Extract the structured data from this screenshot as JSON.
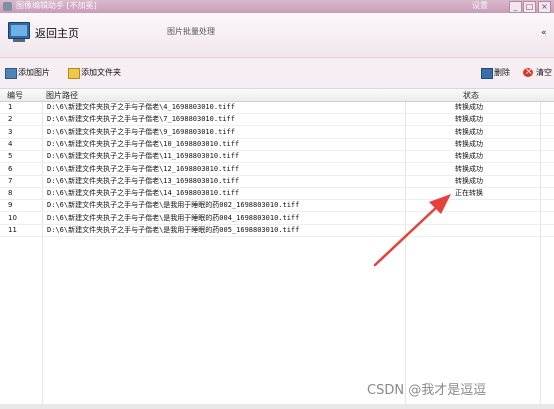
{
  "window": {
    "title": "图像编辑助手 [不加冕]",
    "extra": "设置",
    "buttons": [
      "_",
      "□",
      "×"
    ]
  },
  "header": {
    "back_label": "返回主页",
    "subtitle": "图片批量处理",
    "collapse": "«"
  },
  "toolbar": {
    "add_image": "添加图片",
    "add_folder": "添加文件夹",
    "delete": "删除",
    "clear": "清空"
  },
  "table": {
    "columns": [
      "编号",
      "图片路径",
      "状态"
    ],
    "rows": [
      {
        "no": "1",
        "path": "D:\\6\\新建文件夹执子之手与子偕老\\4_1698803010.tiff",
        "status": "转换成功"
      },
      {
        "no": "2",
        "path": "D:\\6\\新建文件夹执子之手与子偕老\\7_1698803010.tiff",
        "status": "转换成功"
      },
      {
        "no": "3",
        "path": "D:\\6\\新建文件夹执子之手与子偕老\\9_1698803010.tiff",
        "status": "转换成功"
      },
      {
        "no": "4",
        "path": "D:\\6\\新建文件夹执子之手与子偕老\\10_1698803010.tiff",
        "status": "转换成功"
      },
      {
        "no": "5",
        "path": "D:\\6\\新建文件夹执子之手与子偕老\\11_1698803010.tiff",
        "status": "转换成功"
      },
      {
        "no": "6",
        "path": "D:\\6\\新建文件夹执子之手与子偕老\\12_1698803010.tiff",
        "status": "转换成功"
      },
      {
        "no": "7",
        "path": "D:\\6\\新建文件夹执子之手与子偕老\\13_1698803010.tiff",
        "status": "转换成功"
      },
      {
        "no": "8",
        "path": "D:\\6\\新建文件夹执子之手与子偕老\\14_1698803010.tiff",
        "status": "正在转换"
      },
      {
        "no": "9",
        "path": "D:\\6\\新建文件夹执子之手与子偕老\\是我用于睡眠的药002_1698803010.tiff",
        "status": ""
      },
      {
        "no": "10",
        "path": "D:\\6\\新建文件夹执子之手与子偕老\\是我用于睡眠的药004_1698803010.tiff",
        "status": ""
      },
      {
        "no": "11",
        "path": "D:\\6\\新建文件夹执子之手与子偕老\\是我用于睡眠的药005_1698803010.tiff",
        "status": ""
      }
    ]
  },
  "watermark": "CSDN @我才是逗逗",
  "colors": {
    "title_bar": "#c99db8",
    "arrow": "#e8403a",
    "toolbar_bg": "#f6eef3"
  }
}
